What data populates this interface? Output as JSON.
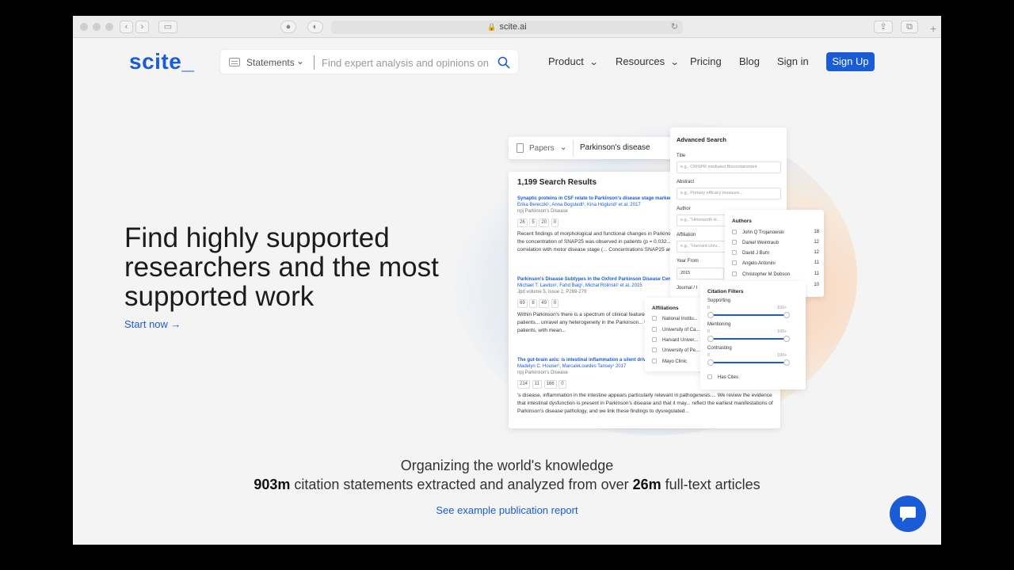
{
  "browser": {
    "url": "scite.ai"
  },
  "nav": {
    "logo": "scite_",
    "search": {
      "type_label": "Statements",
      "placeholder": "Find expert analysis and opinions on ..."
    },
    "items": [
      {
        "label": "Product"
      },
      {
        "label": "Resources"
      },
      {
        "label": "Pricing"
      },
      {
        "label": "Blog"
      },
      {
        "label": "Sign in"
      }
    ],
    "signup_label": "Sign Up"
  },
  "hero": {
    "title": "Find highly supported researchers and the most supported work",
    "cta": "Start now"
  },
  "mock": {
    "search_type": "Papers",
    "query": "Parkinson's disease",
    "result_count": "1,199 Search Results",
    "results": [
      {
        "title": "Synaptic proteins in CSF relate to Parkinson's disease stage markers",
        "authors": "Erika Bereczki¹, Anna Bogstedt¹, Kina Höglund¹ et al. 2017",
        "journal": "npj Parkinson's Disease",
        "tallies": [
          "26",
          "5",
          "20",
          "0"
        ],
        "snippet": "Recent findings of morphological and functional changes in Parkinson's disease altered... An overall increase in the concentration of SNAP25 was observed in patients (p = 0.032... 's disease group (p = 0.017), as well as in correlation with motor disease stage (... Concentrations SNAP25 and neurogranin..."
      },
      {
        "title": "Parkinson's Disease Subtypes in the Oxford Parkinson Disease Centre",
        "authors": "Michael T. Lawton¹, Fahd Baig¹, Michal Rolinski¹ et al. 2015",
        "journal": "Jpd volume 5, issue 2, P269-279",
        "tallies": [
          "69",
          "6",
          "49",
          "0"
        ],
        "snippet": "Within Parkinson's there is a spectrum of clinical features... sub-types of the disease.... how best to group patients... unravel any heterogeneity in the Parkinson... well-characterised cohort.Methods: 769 consecutive patients, with mean..."
      },
      {
        "title": "The gut-brain axis: is intestinal inflammation a silent driver...",
        "authors": "Madelyn C. Houser¹, MarcaleLourdes Tansey¹ 2017",
        "journal": "npj Parkinson's Disease",
        "tallies": [
          "214",
          "11",
          "166",
          "0"
        ],
        "snippet": "'s disease, inflammation in the intestine appears particularly relevant in pathogenesis.... We review the evidence that intestinal dysfunction is present in Parkinson's disease and that it may... reflect the earliest manifestations of Parkinson's disease pathology, and we link these findings to dysregulated..."
      }
    ],
    "advanced": {
      "title": "Advanced Search",
      "fields": [
        {
          "label": "Title",
          "placeholder": "e.g., CRISPR mediated Biocontainment"
        },
        {
          "label": "Abstract",
          "placeholder": "e.g., Primary efficacy measure..."
        },
        {
          "label": "Author",
          "placeholder": "e.g., \"Himsworth H..."
        },
        {
          "label": "Affiliation",
          "placeholder": "e.g., \"Harvard Univ..."
        },
        {
          "label": "Year From",
          "placeholder": "2015"
        },
        {
          "label": "Journal / I",
          "placeholder": ""
        }
      ]
    },
    "authors": {
      "title": "Authors",
      "items": [
        {
          "name": "John Q Trojanowski",
          "count": "18"
        },
        {
          "name": "Daniel Weintraub",
          "count": "12"
        },
        {
          "name": "David J Burn",
          "count": "12"
        },
        {
          "name": "Angelo Antonini",
          "count": "11"
        },
        {
          "name": "Christopher M Dobson",
          "count": "11"
        },
        {
          "name": "",
          "count": "10"
        }
      ]
    },
    "affiliations": {
      "title": "Affiliations",
      "items": [
        "National Institu...",
        "University of Ca...",
        "Harvard Univer...",
        "University of Pe...",
        "Mayo Clinic"
      ]
    },
    "citation_filters": {
      "title": "Citation Filters",
      "sliders": [
        {
          "label": "Supporting",
          "min": "0",
          "max": "100+"
        },
        {
          "label": "Mentioning",
          "min": "0",
          "max": "100+"
        },
        {
          "label": "Contrasting",
          "min": "0",
          "max": "100+"
        }
      ],
      "has_cites": "Has Cites"
    }
  },
  "stats": {
    "tagline": "Organizing the world's knowledge",
    "statements_count": "903m",
    "statements_text": " citation statements extracted and analyzed from over ",
    "articles_count": "26m",
    "articles_text": " full-text articles",
    "report_link": "See example publication report"
  }
}
